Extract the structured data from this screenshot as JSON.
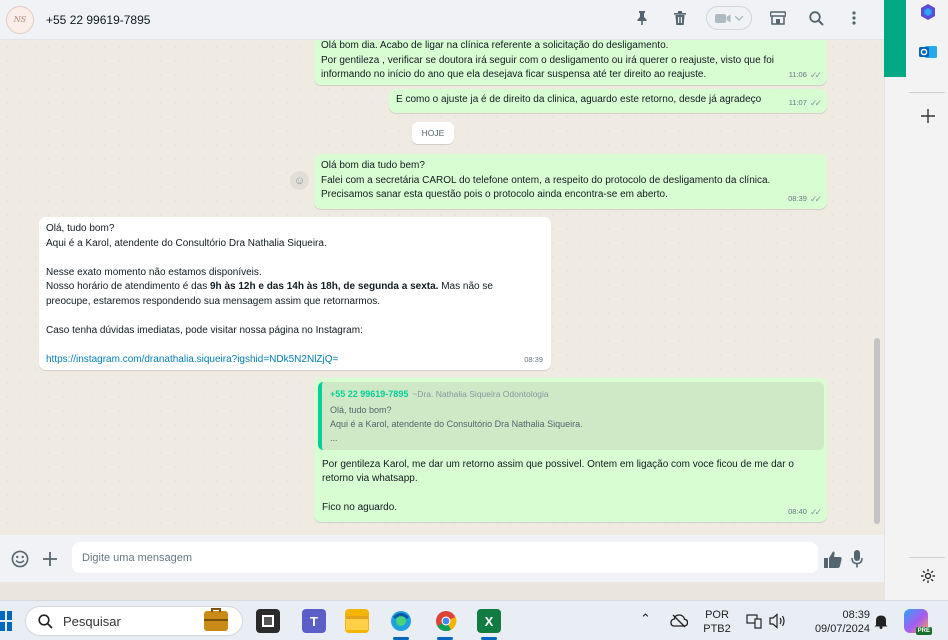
{
  "header": {
    "avatar_text": "NS",
    "contact_name": "+55 22 99619-7895",
    "icons": [
      "pin-icon",
      "trash-icon",
      "video-call-icon",
      "store-icon",
      "search-icon",
      "menu-icon"
    ]
  },
  "messages": [
    {
      "lines": [
        "Olá bom dia. Acabo de ligar na clínica referente a solicitação do desligamento.",
        "Por gentileza , verificar se doutora irá seguir com o desligamento ou irá querer o reajuste, visto que foi",
        "informando no início do ano que ela desejava ficar suspensa até ter direito ao reajuste."
      ],
      "time": "11:06"
    },
    {
      "lines": [
        "E como o ajuste ja é de direito da clinica, aguardo este retorno, desde já agradeço"
      ],
      "time": "11:07"
    },
    {
      "lines": [
        "Olá bom dia tudo bem?",
        "Falei com a secretária CAROL do telefone ontem, a respeito do protocolo de desligamento da clínica.",
        "Precisamos sanar esta questão pois o protocolo ainda encontra-se em aberto."
      ],
      "time": "08:39"
    }
  ],
  "date_chip": "HOJE",
  "auto_reply": {
    "line1": "Olá, tudo bom?",
    "line2": "Aqui é a Karol, atendente do Consultório Dra Nathalia Siqueira.",
    "line3": "Nesse exato momento não estamos disponíveis.",
    "line4_pre": "Nosso horário de atendimento é das ",
    "line4_bold": "9h às 12h e das 14h às 18h, de segunda a sexta.",
    "line4_post": " Mas não se",
    "line5": "preocupe, estaremos respondendo sua mensagem assim que retornarmos.",
    "line6": "Caso tenha dúvidas imediatas, pode visitar nossa página no Instagram:",
    "link": "https://instagram.com/dranathalia.siqueira?igshid=NDk5N2NlZjQ=",
    "time": "08:39"
  },
  "reply": {
    "quote_author": "+55 22 99619-7895",
    "quote_sub": "~Dra. Nathalia Siqueira Odontologia",
    "quote_lines": [
      "Olá, tudo bom?",
      "Aqui é a Karol, atendente do Consultório Dra Nathalia Siqueira.",
      "..."
    ],
    "line1": "Por gentileza Karol, me dar um retorno assim que possivel. Ontem em ligação com voce ficou de me dar o",
    "line2": "retorno via whatsapp.",
    "line3": "Fico no aguardo.",
    "time": "08:40"
  },
  "composer": {
    "placeholder": "Digite uma mensagem"
  },
  "taskbar": {
    "search_placeholder": "Pesquisar",
    "lang_top": "POR",
    "lang_bottom": "PTB2",
    "time": "08:39",
    "date": "09/07/2024",
    "copilot_badge": "PRE"
  },
  "colors": {
    "outgoing_bubble": "#d9fdd3",
    "incoming_bubble": "#ffffff",
    "accent": "#00a884",
    "quote_accent": "#06cf9c"
  }
}
